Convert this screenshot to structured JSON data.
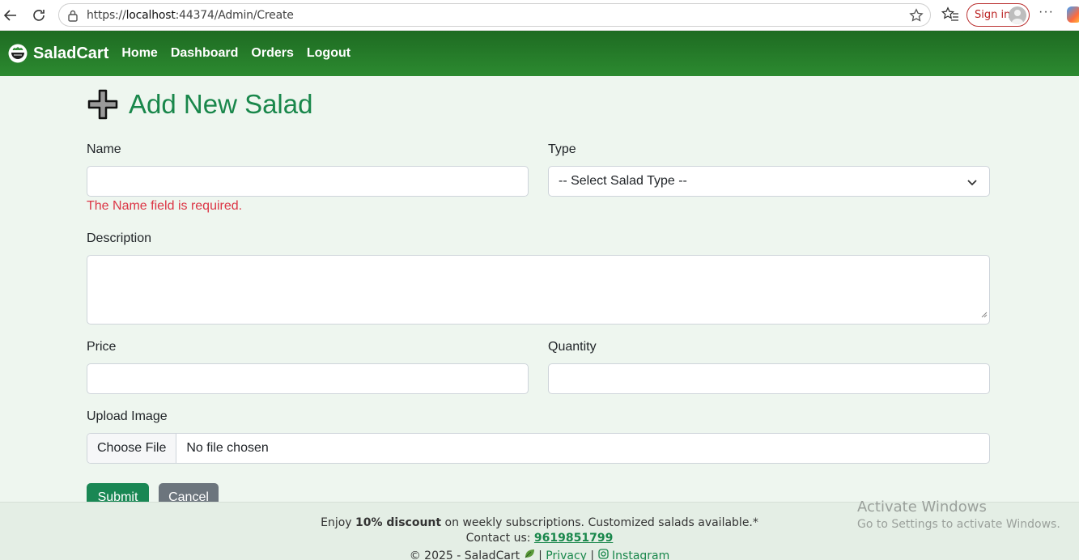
{
  "browser": {
    "url_prefix": "https://",
    "url_host": "localhost",
    "url_rest": ":44374/Admin/Create",
    "signin_label": "Sign in"
  },
  "navbar": {
    "brand": "SaladCart",
    "links": [
      "Home",
      "Dashboard",
      "Orders",
      "Logout"
    ]
  },
  "page": {
    "title": "Add New Salad"
  },
  "form": {
    "name_label": "Name",
    "name_value": "",
    "name_error": "The Name field is required.",
    "type_label": "Type",
    "type_selected": "-- Select Salad Type --",
    "description_label": "Description",
    "price_label": "Price",
    "quantity_label": "Quantity",
    "upload_label": "Upload Image",
    "choose_file_label": "Choose File",
    "file_status": "No file chosen",
    "submit_label": "Submit",
    "cancel_label": "Cancel"
  },
  "footer": {
    "promo_prefix": "Enjoy ",
    "promo_bold": "10% discount",
    "promo_suffix": " on weekly subscriptions. Customized salads available.*",
    "contact_prefix": "Contact us: ",
    "contact_phone": "9619851799",
    "copyright": "© 2025 - SaladCart",
    "privacy": "Privacy",
    "instagram": "Instagram"
  },
  "watermark": {
    "title": "Activate Windows",
    "subtitle": "Go to Settings to activate Windows."
  },
  "colors": {
    "navbar": "#2c8a30",
    "title": "#19874b",
    "error": "#dc3545",
    "submit": "#198754",
    "cancel": "#6c757d"
  },
  "icons": [
    "back-arrow-icon",
    "refresh-icon",
    "lock-icon",
    "star-icon",
    "favorites-icon",
    "salad-bowl-icon",
    "plus-icon",
    "chevron-down-icon",
    "leaf-icon",
    "instagram-icon"
  ]
}
